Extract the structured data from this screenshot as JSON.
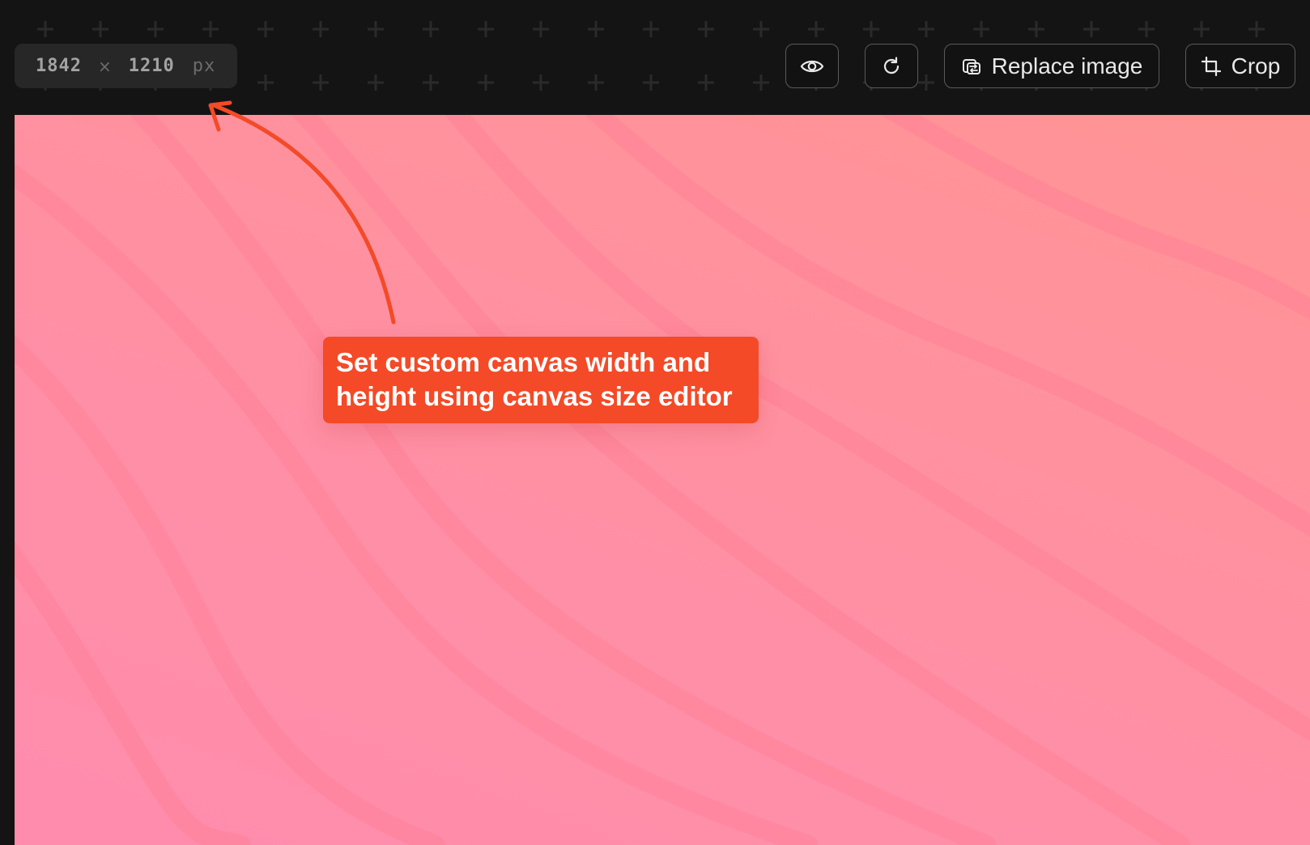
{
  "toolbar": {
    "canvas_size": {
      "width": "1842",
      "separator": "×",
      "height": "1210",
      "unit": "px"
    },
    "buttons": {
      "preview_icon": "eye-icon",
      "reset_icon": "rotate-icon",
      "replace_label": "Replace image",
      "replace_icon": "replace-icon",
      "crop_label": "Crop",
      "crop_icon": "crop-icon"
    }
  },
  "annotation": {
    "line1": "Set custom canvas width and",
    "line2": "height using canvas size editor"
  },
  "colors": {
    "background": "#141414",
    "canvas_gradient_start": "#ff9494",
    "canvas_gradient_end": "#ff8cad",
    "callout": "#f44a27",
    "arrow": "#f44a27"
  }
}
